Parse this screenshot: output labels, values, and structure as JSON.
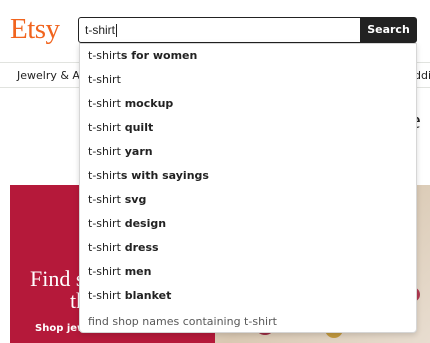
{
  "header": {
    "logo": "Etsy",
    "search": {
      "value": "t-shirt"
    },
    "search_button": "Search"
  },
  "nav": {
    "left_item": "Jewelry & Ac",
    "right_item": "ddi"
  },
  "peek_text": "e",
  "hero": {
    "title_line1": "Find s",
    "title_line2": "th",
    "link": "Shop jewel"
  },
  "suggestions": [
    {
      "q": "t-shirt",
      "rest": "s for women"
    },
    {
      "q": "t-shirt",
      "rest": ""
    },
    {
      "q": "t-shirt",
      "rest": " mockup"
    },
    {
      "q": "t-shirt",
      "rest": " quilt"
    },
    {
      "q": "t-shirt",
      "rest": " yarn"
    },
    {
      "q": "t-shirt",
      "rest": "s with sayings"
    },
    {
      "q": "t-shirt",
      "rest": " svg"
    },
    {
      "q": "t-shirt",
      "rest": " design"
    },
    {
      "q": "t-shirt",
      "rest": " dress"
    },
    {
      "q": "t-shirt",
      "rest": " men"
    },
    {
      "q": "t-shirt",
      "rest": " blanket"
    }
  ],
  "shop_search": "find shop names containing t-shirt",
  "colors": {
    "brand": "#F1641E",
    "hero": "#B5193A",
    "button": "#222222"
  }
}
